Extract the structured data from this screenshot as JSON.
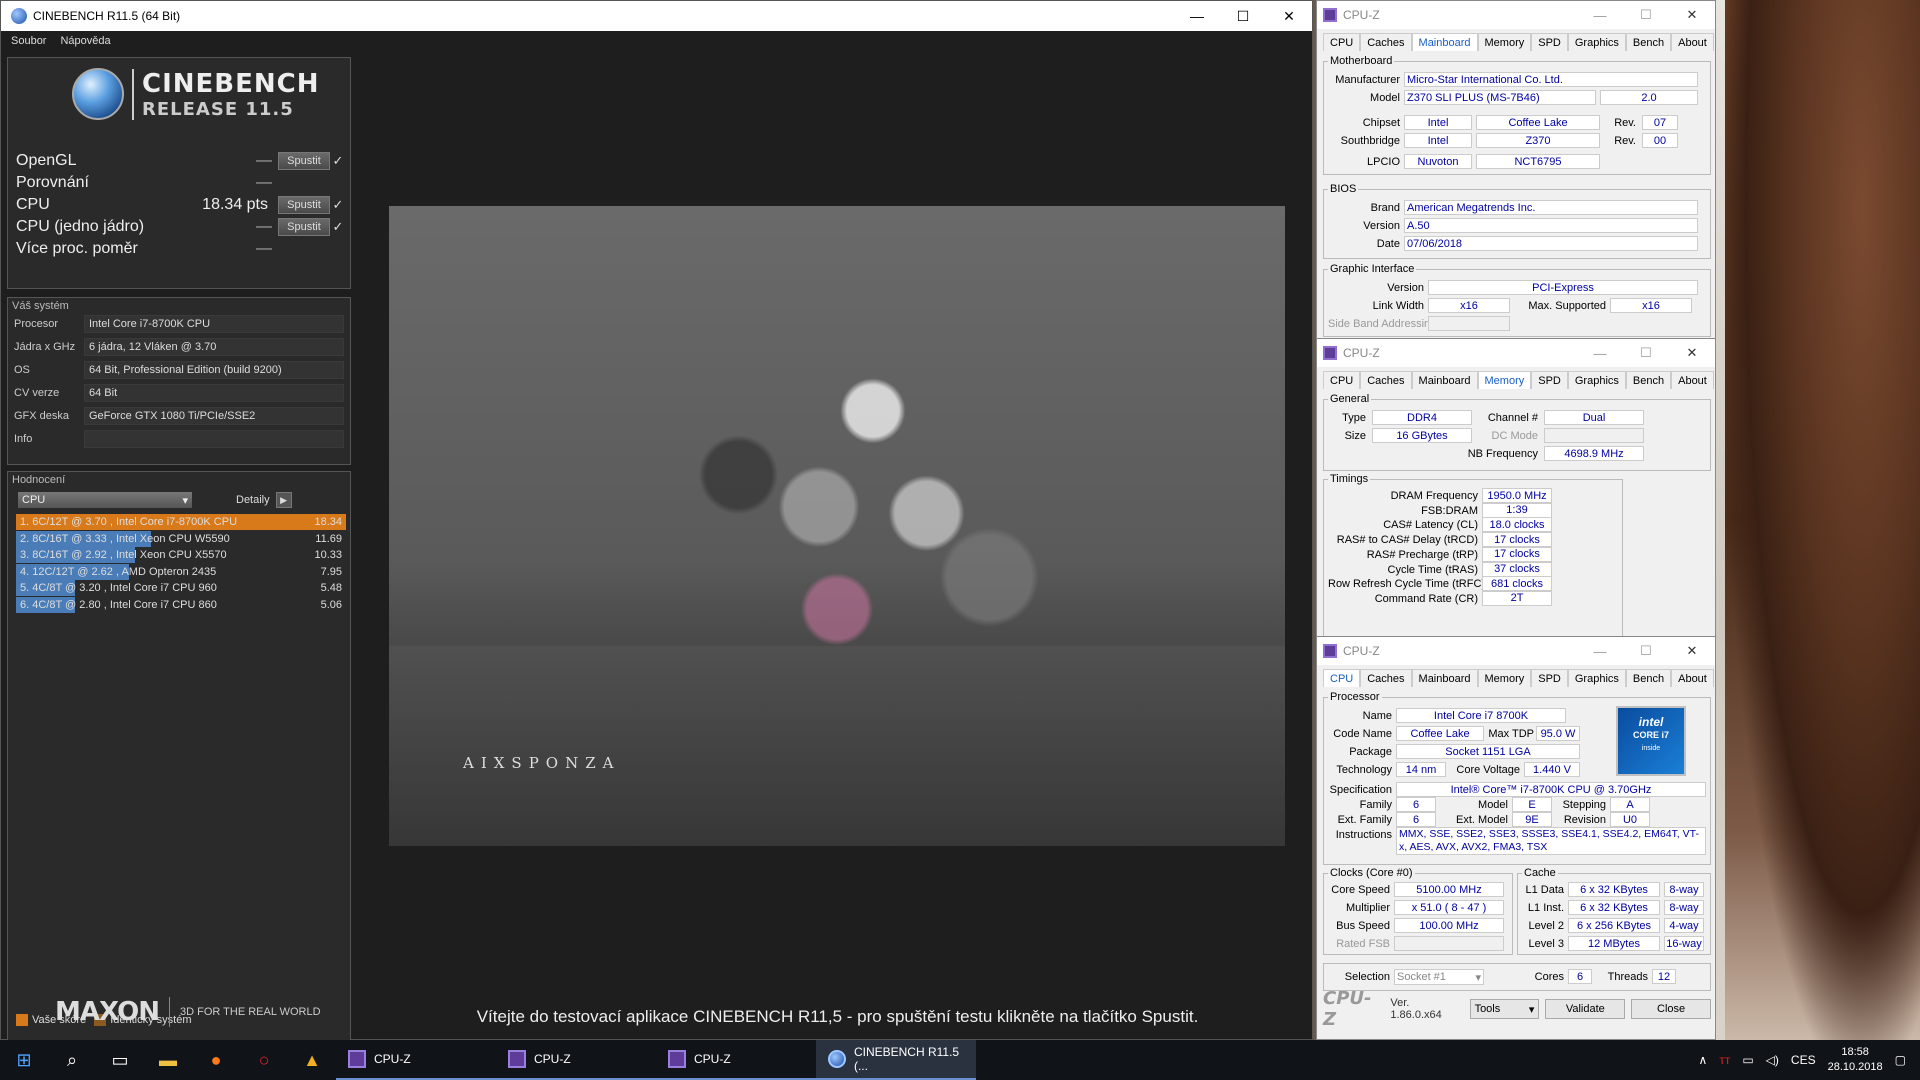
{
  "cinebench": {
    "window_title": "CINEBENCH R11.5 (64 Bit)",
    "menu": [
      "Soubor",
      "Nápověda"
    ],
    "logo_line1": "CINEBENCH",
    "logo_line2": "RELEASE 11.5",
    "tests": [
      {
        "label": "OpenGL",
        "score": "",
        "dash": "—",
        "button": "Spustit",
        "check": "✓"
      },
      {
        "label": "Porovnání",
        "score": "",
        "dash": "—",
        "button": "",
        "check": ""
      },
      {
        "label": "CPU",
        "score": "18.34 pts",
        "dash": "",
        "button": "Spustit",
        "check": "✓"
      },
      {
        "label": "CPU (jedno jádro)",
        "score": "",
        "dash": "—",
        "button": "Spustit",
        "check": "✓"
      },
      {
        "label": "Více proc. poměr",
        "score": "",
        "dash": "—",
        "button": "",
        "check": ""
      }
    ],
    "system_title": "Váš systém",
    "system": [
      {
        "k": "Procesor",
        "v": "Intel Core i7-8700K CPU"
      },
      {
        "k": "Jádra x GHz",
        "v": "6 jádra, 12 Vláken @ 3.70"
      },
      {
        "k": "OS",
        "v": "64 Bit, Professional Edition (build 9200)"
      },
      {
        "k": "CV verze",
        "v": "64 Bit"
      },
      {
        "k": "GFX deska",
        "v": "GeForce GTX 1080 Ti/PCIe/SSE2"
      },
      {
        "k": "Info",
        "v": ""
      }
    ],
    "ranking_title": "Hodnocení",
    "ranking_select": "CPU",
    "ranking_details": "Detaily",
    "ranking": [
      {
        "text": "1. 6C/12T @ 3.70 , Intel Core i7-8700K CPU",
        "value": "18.34",
        "fill": 1.0
      },
      {
        "text": "2. 8C/16T @ 3.33 , Intel Xeon CPU W5590",
        "value": "11.69",
        "fill": 0.5
      },
      {
        "text": "3. 8C/16T @ 2.92 , Intel Xeon CPU X5570",
        "value": "10.33",
        "fill": 0.44
      },
      {
        "text": "4. 12C/12T @ 2.62 , AMD Opteron 2435",
        "value": "7.95",
        "fill": 0.42
      },
      {
        "text": "5. 4C/8T @ 3.20 , Intel Core i7 CPU 960",
        "value": "5.48",
        "fill": 0.22
      },
      {
        "text": "6. 4C/8T @ 2.80 , Intel Core i7 CPU 860",
        "value": "5.06",
        "fill": 0.22
      }
    ],
    "legend_yours": "Vaše skóre",
    "legend_identical": "Identický systém",
    "maxon_logo": "MAXON",
    "maxon_tag": "3D FOR THE REAL WORLD",
    "render_brand": "AIXSPONZA",
    "welcome": "Vítejte do testovací aplikace CINEBENCH R11,5  - pro spuštění testu klikněte na tlačítko Spustit."
  },
  "cpuz_mainboard": {
    "title": "CPU-Z",
    "tabs": [
      "CPU",
      "Caches",
      "Mainboard",
      "Memory",
      "SPD",
      "Graphics",
      "Bench",
      "About"
    ],
    "active_tab": "Mainboard",
    "motherboard_title": "Motherboard",
    "manufacturer_label": "Manufacturer",
    "manufacturer": "Micro-Star International Co. Ltd.",
    "model_label": "Model",
    "model": "Z370 SLI PLUS (MS-7B46)",
    "model_rev": "2.0",
    "chipset_label": "Chipset",
    "chipset_vendor": "Intel",
    "chipset_name": "Coffee Lake",
    "chipset_rev_label": "Rev.",
    "chipset_rev": "07",
    "southbridge_label": "Southbridge",
    "sb_vendor": "Intel",
    "sb_name": "Z370",
    "sb_rev_label": "Rev.",
    "sb_rev": "00",
    "lpcio_label": "LPCIO",
    "lpcio_vendor": "Nuvoton",
    "lpcio_name": "NCT6795",
    "bios_title": "BIOS",
    "bios_brand_label": "Brand",
    "bios_brand": "American Megatrends Inc.",
    "bios_version_label": "Version",
    "bios_version": "A.50",
    "bios_date_label": "Date",
    "bios_date": "07/06/2018",
    "gi_title": "Graphic Interface",
    "gi_version_label": "Version",
    "gi_version": "PCI-Express",
    "gi_link_label": "Link Width",
    "gi_link": "x16",
    "gi_max_label": "Max. Supported",
    "gi_max": "x16",
    "gi_sba_label": "Side Band Addressing"
  },
  "cpuz_memory": {
    "title": "CPU-Z",
    "tabs": [
      "CPU",
      "Caches",
      "Mainboard",
      "Memory",
      "SPD",
      "Graphics",
      "Bench",
      "About"
    ],
    "active_tab": "Memory",
    "general_title": "General",
    "type_label": "Type",
    "type": "DDR4",
    "channel_label": "Channel #",
    "channel": "Dual",
    "size_label": "Size",
    "size": "16 GBytes",
    "dcmode_label": "DC Mode",
    "nbfreq_label": "NB Frequency",
    "nbfreq": "4698.9 MHz",
    "timings_title": "Timings",
    "timings": [
      {
        "k": "DRAM Frequency",
        "v": "1950.0 MHz"
      },
      {
        "k": "FSB:DRAM",
        "v": "1:39"
      },
      {
        "k": "CAS# Latency (CL)",
        "v": "18.0 clocks"
      },
      {
        "k": "RAS# to CAS# Delay (tRCD)",
        "v": "17 clocks"
      },
      {
        "k": "RAS# Precharge (tRP)",
        "v": "17 clocks"
      },
      {
        "k": "Cycle Time (tRAS)",
        "v": "37 clocks"
      },
      {
        "k": "Row Refresh Cycle Time (tRFC)",
        "v": "681 clocks"
      },
      {
        "k": "Command Rate (CR)",
        "v": "2T"
      }
    ]
  },
  "cpuz_cpu": {
    "title": "CPU-Z",
    "tabs": [
      "CPU",
      "Caches",
      "Mainboard",
      "Memory",
      "SPD",
      "Graphics",
      "Bench",
      "About"
    ],
    "active_tab": "CPU",
    "processor_title": "Processor",
    "name_label": "Name",
    "name": "Intel Core i7 8700K",
    "codename_label": "Code Name",
    "codename": "Coffee Lake",
    "maxtdp_label": "Max TDP",
    "maxtdp": "95.0 W",
    "package_label": "Package",
    "package": "Socket 1151 LGA",
    "tech_label": "Technology",
    "tech": "14 nm",
    "corev_label": "Core Voltage",
    "corev": "1.440 V",
    "spec_label": "Specification",
    "spec": "Intel® Core™ i7-8700K CPU @ 3.70GHz",
    "family_label": "Family",
    "family": "6",
    "model_label": "Model",
    "model": "E",
    "stepping_label": "Stepping",
    "stepping": "A",
    "extfamily_label": "Ext. Family",
    "extfamily": "6",
    "extmodel_label": "Ext. Model",
    "extmodel": "9E",
    "revision_label": "Revision",
    "revision": "U0",
    "instr_label": "Instructions",
    "instr": "MMX, SSE, SSE2, SSE3, SSSE3, SSE4.1, SSE4.2, EM64T, VT-x, AES, AVX, AVX2, FMA3, TSX",
    "intel_badge_1": "intel",
    "intel_badge_2": "CORE i7",
    "intel_badge_3": "inside",
    "clocks_title": "Clocks (Core #0)",
    "corespeed_label": "Core Speed",
    "corespeed": "5100.00 MHz",
    "multiplier_label": "Multiplier",
    "multiplier": "x 51.0 ( 8 - 47 )",
    "busspeed_label": "Bus Speed",
    "busspeed": "100.00 MHz",
    "ratedfsb_label": "Rated FSB",
    "cache_title": "Cache",
    "caches": [
      {
        "k": "L1 Data",
        "v": "6 x 32 KBytes",
        "w": "8-way"
      },
      {
        "k": "L1 Inst.",
        "v": "6 x 32 KBytes",
        "w": "8-way"
      },
      {
        "k": "Level 2",
        "v": "6 x 256 KBytes",
        "w": "4-way"
      },
      {
        "k": "Level 3",
        "v": "12 MBytes",
        "w": "16-way"
      }
    ],
    "selection_label": "Selection",
    "selection": "Socket #1",
    "cores_label": "Cores",
    "cores": "6",
    "threads_label": "Threads",
    "threads": "12",
    "brand": "CPU-Z",
    "version": "Ver. 1.86.0.x64",
    "tools_button": "Tools",
    "validate_button": "Validate",
    "close_button": "Close"
  },
  "taskbar": {
    "apps": [
      {
        "label": "CPU-Z"
      },
      {
        "label": "CPU-Z"
      },
      {
        "label": "CPU-Z"
      },
      {
        "label": "CINEBENCH R11.5 (..."
      }
    ],
    "language": "CES",
    "time": "18:58",
    "date": "28.10.2018"
  }
}
